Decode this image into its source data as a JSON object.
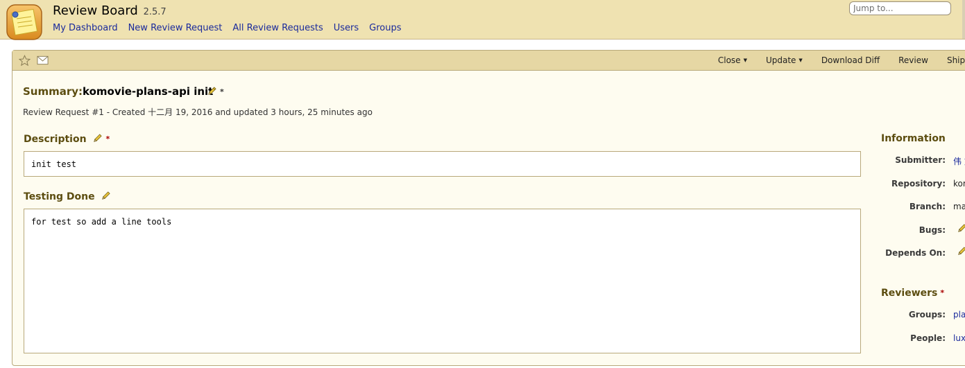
{
  "header": {
    "brand": "Review Board",
    "version": "2.5.7",
    "nav": [
      "My Dashboard",
      "New Review Request",
      "All Review Requests",
      "Users",
      "Groups"
    ],
    "jump_placeholder": "Jump to..."
  },
  "actionbar": {
    "actions": [
      {
        "label": "Close",
        "dropdown": true
      },
      {
        "label": "Update",
        "dropdown": true
      },
      {
        "label": "Download Diff",
        "dropdown": false
      },
      {
        "label": "Review",
        "dropdown": false
      },
      {
        "label": "Ship It!",
        "dropdown": false
      }
    ]
  },
  "review": {
    "summary_label": "Summary:",
    "summary": "komovie-plans-api init",
    "required_marker": "*",
    "created_line": "Review Request #1 - Created 十二月 19, 2016 and updated 3 hours, 25 minutes ago",
    "description_label": "Description",
    "description": "init test",
    "testing_label": "Testing Done",
    "testing": "for test so add a line tools"
  },
  "sidebar": {
    "information_heading": "Information",
    "fields": [
      {
        "label": "Submitter:",
        "value": "伟 刘"
      },
      {
        "label": "Repository:",
        "value": "komovie"
      },
      {
        "label": "Branch:",
        "value": "master"
      },
      {
        "label": "Bugs:",
        "value": ""
      },
      {
        "label": "Depends On:",
        "value": ""
      }
    ],
    "reviewers_heading": "Reviewers",
    "reviewers": [
      {
        "label": "Groups:",
        "value": "plans"
      },
      {
        "label": "People:",
        "value": "luxin"
      }
    ]
  },
  "colors": {
    "header_bg": "#efe2b1",
    "actionbar_bg": "#e6d7a4",
    "box_bg": "#fefcf0",
    "heading": "#5c4d10",
    "link": "#1a2a9c"
  }
}
